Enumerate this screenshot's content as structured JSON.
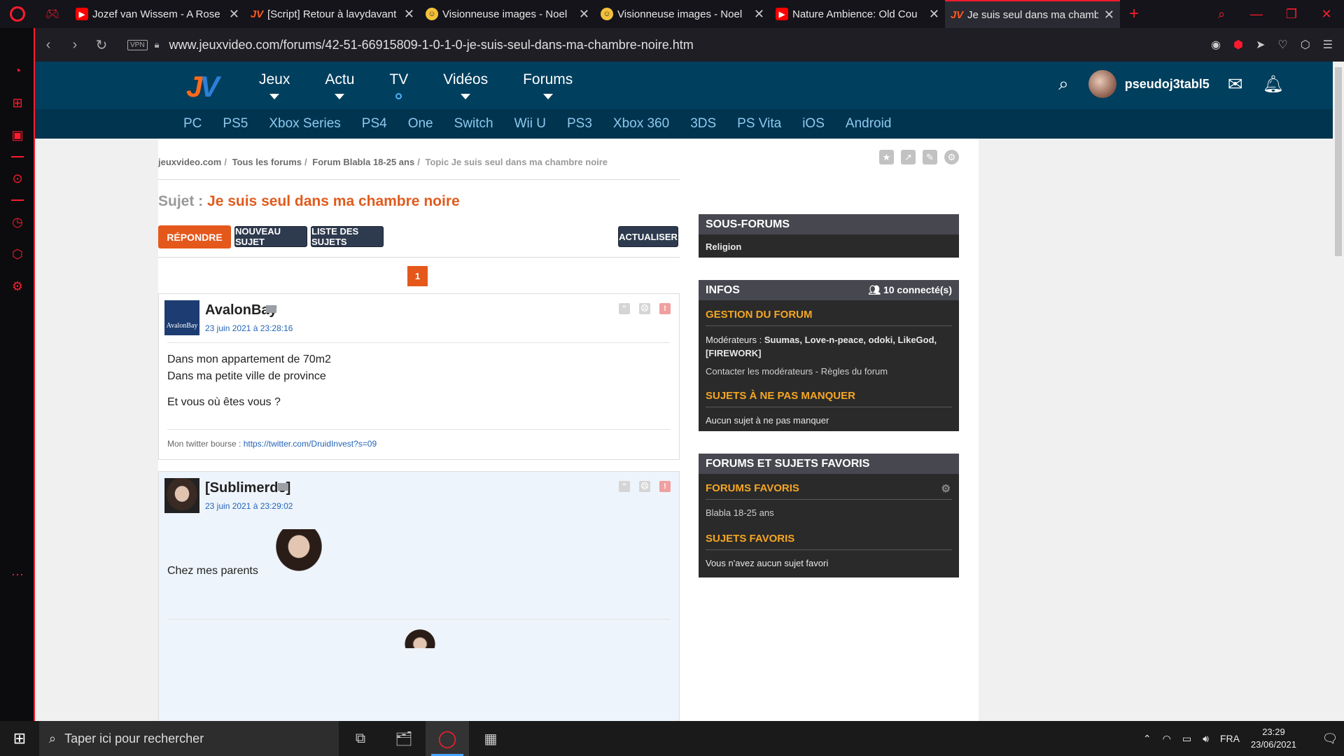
{
  "browser": {
    "tabs": [
      {
        "title": "Jozef van Wissem - A Rose",
        "favicon": "youtube-icon"
      },
      {
        "title": "[Script] Retour à lavydavant",
        "favicon": "jv-icon"
      },
      {
        "title": "Visionneuse images - Noel",
        "favicon": "image-viewer-icon"
      },
      {
        "title": "Visionneuse images - Noel",
        "favicon": "image-viewer-icon"
      },
      {
        "title": "Nature Ambience: Old Cou",
        "favicon": "youtube-icon"
      },
      {
        "title": "Je suis seul dans ma chamb",
        "favicon": "jv-icon",
        "active": true
      }
    ],
    "url": "www.jeuxvideo.com/forums/42-51-66915809-1-0-1-0-je-suis-seul-dans-ma-chambre-noire.htm",
    "vpn_label": "VPN",
    "accent": "#ff1b2d"
  },
  "site": {
    "main_nav": [
      "Jeux",
      "Actu",
      "TV",
      "Vidéos",
      "Forums"
    ],
    "username": "pseudoj3tabl5",
    "sub_nav": [
      "PC",
      "PS5",
      "Xbox Series",
      "PS4",
      "One",
      "Switch",
      "Wii U",
      "PS3",
      "Xbox 360",
      "3DS",
      "PS Vita",
      "iOS",
      "Android"
    ]
  },
  "topic": {
    "breadcrumb": [
      "jeuxvideo.com",
      "Tous les forums",
      "Forum Blabla 18-25 ans",
      "Topic Je suis seul dans ma chambre noire"
    ],
    "subject_prefix": "Sujet :",
    "subject": "Je suis seul dans ma chambre noire",
    "buttons": {
      "reply": "RÉPONDRE",
      "new_topic": "NOUVEAU SUJET",
      "topic_list": "LISTE DES SUJETS",
      "refresh": "ACTUALISER"
    },
    "page": "1"
  },
  "posts": [
    {
      "author": "AvalonBay",
      "date": "23 juin 2021 à 23:28:16",
      "lines": [
        "Dans mon appartement de 70m2",
        "Dans ma petite ville de province",
        "Et vous où êtes vous ?"
      ],
      "signature_prefix": "Mon twitter bourse :",
      "signature_link": "https://twitter.com/DruidInvest?s=09",
      "avatar_text": "AvalonBay"
    },
    {
      "author": "[Sublimerde]",
      "date": "23 juin 2021 à 23:29:02",
      "lines": [
        "Chez mes parents"
      ]
    }
  ],
  "sidebar": {
    "sous_forums": {
      "title": "SOUS-FORUMS",
      "items": [
        "Religion"
      ]
    },
    "infos": {
      "title": "INFOS",
      "connected": "10 connecté(s)",
      "gestion_title": "GESTION DU FORUM",
      "moderators_label": "Modérateurs :",
      "moderators": "Suumas, Love-n-peace, odoki, LikeGod, [FIREWORK]",
      "contact": "Contacter les modérateurs - Règles du forum",
      "sujets_title": "SUJETS À NE PAS MANQUER",
      "sujets_empty": "Aucun sujet à ne pas manquer"
    },
    "favoris": {
      "title": "FORUMS ET SUJETS FAVORIS",
      "forums_title": "FORUMS FAVORIS",
      "forums": [
        "Blabla 18-25 ans"
      ],
      "sujets_title": "SUJETS FAVORIS",
      "sujets_empty": "Vous n'avez aucun sujet favori"
    }
  },
  "taskbar": {
    "search_placeholder": "Taper ici pour rechercher",
    "language": "FRA",
    "time": "23:29",
    "date": "23/06/2021"
  }
}
